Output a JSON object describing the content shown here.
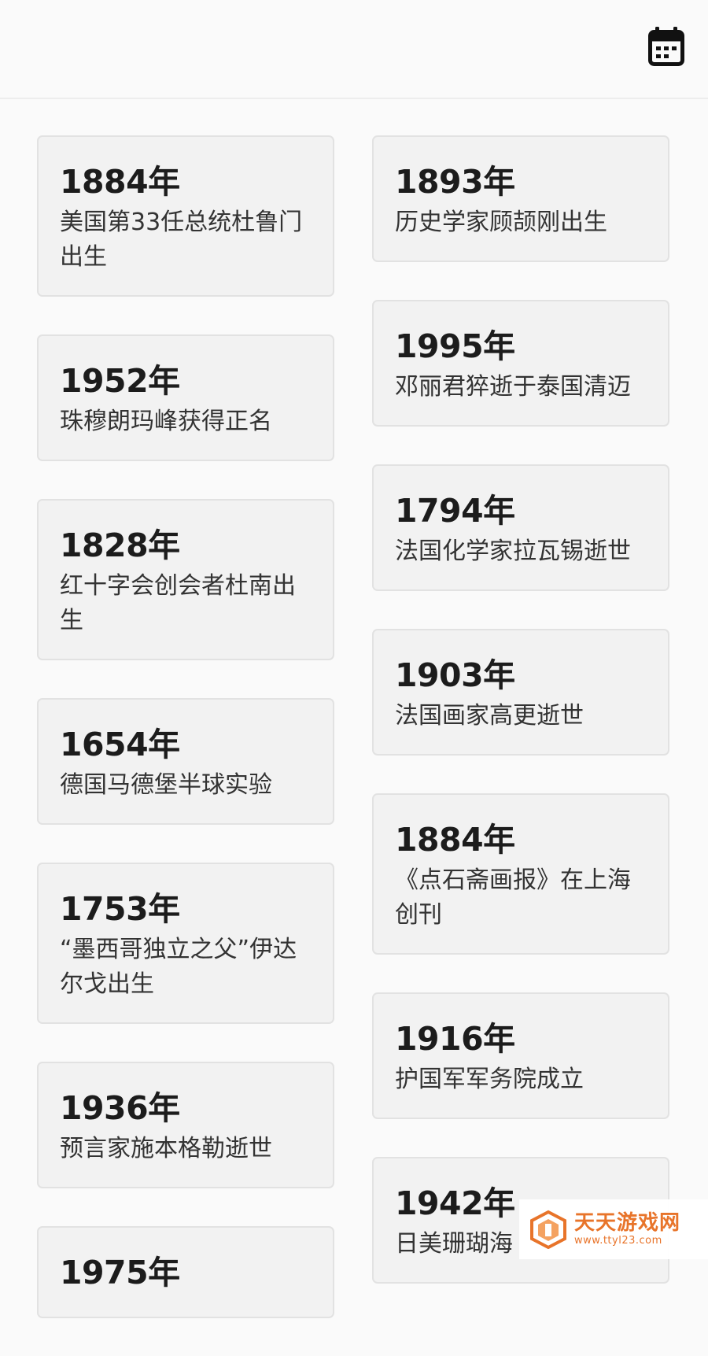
{
  "toolbar": {
    "calendar_icon": "calendar-icon"
  },
  "columns": {
    "left": [
      {
        "year": "1884年",
        "event": "美国第33任总统杜鲁门出生"
      },
      {
        "year": "1952年",
        "event": "珠穆朗玛峰获得正名"
      },
      {
        "year": "1828年",
        "event": "红十字会创会者杜南出生"
      },
      {
        "year": "1654年",
        "event": "德国马德堡半球实验"
      },
      {
        "year": "1753年",
        "event": "“墨西哥独立之父”伊达尔戈出生"
      },
      {
        "year": "1936年",
        "event": "预言家施本格勒逝世"
      },
      {
        "year": "1975年",
        "event": ""
      }
    ],
    "right": [
      {
        "year": "1893年",
        "event": "历史学家顾颉刚出生"
      },
      {
        "year": "1995年",
        "event": "邓丽君猝逝于泰国清迈"
      },
      {
        "year": "1794年",
        "event": "法国化学家拉瓦锡逝世"
      },
      {
        "year": "1903年",
        "event": "法国画家高更逝世"
      },
      {
        "year": "1884年",
        "event": "《点石斋画报》在上海创刊"
      },
      {
        "year": "1916年",
        "event": "护国军军务院成立"
      },
      {
        "year": "1942年",
        "event": "日美珊瑚海"
      }
    ]
  },
  "watermark": {
    "title": "天天游戏网",
    "url": "www.ttyl23.com"
  }
}
